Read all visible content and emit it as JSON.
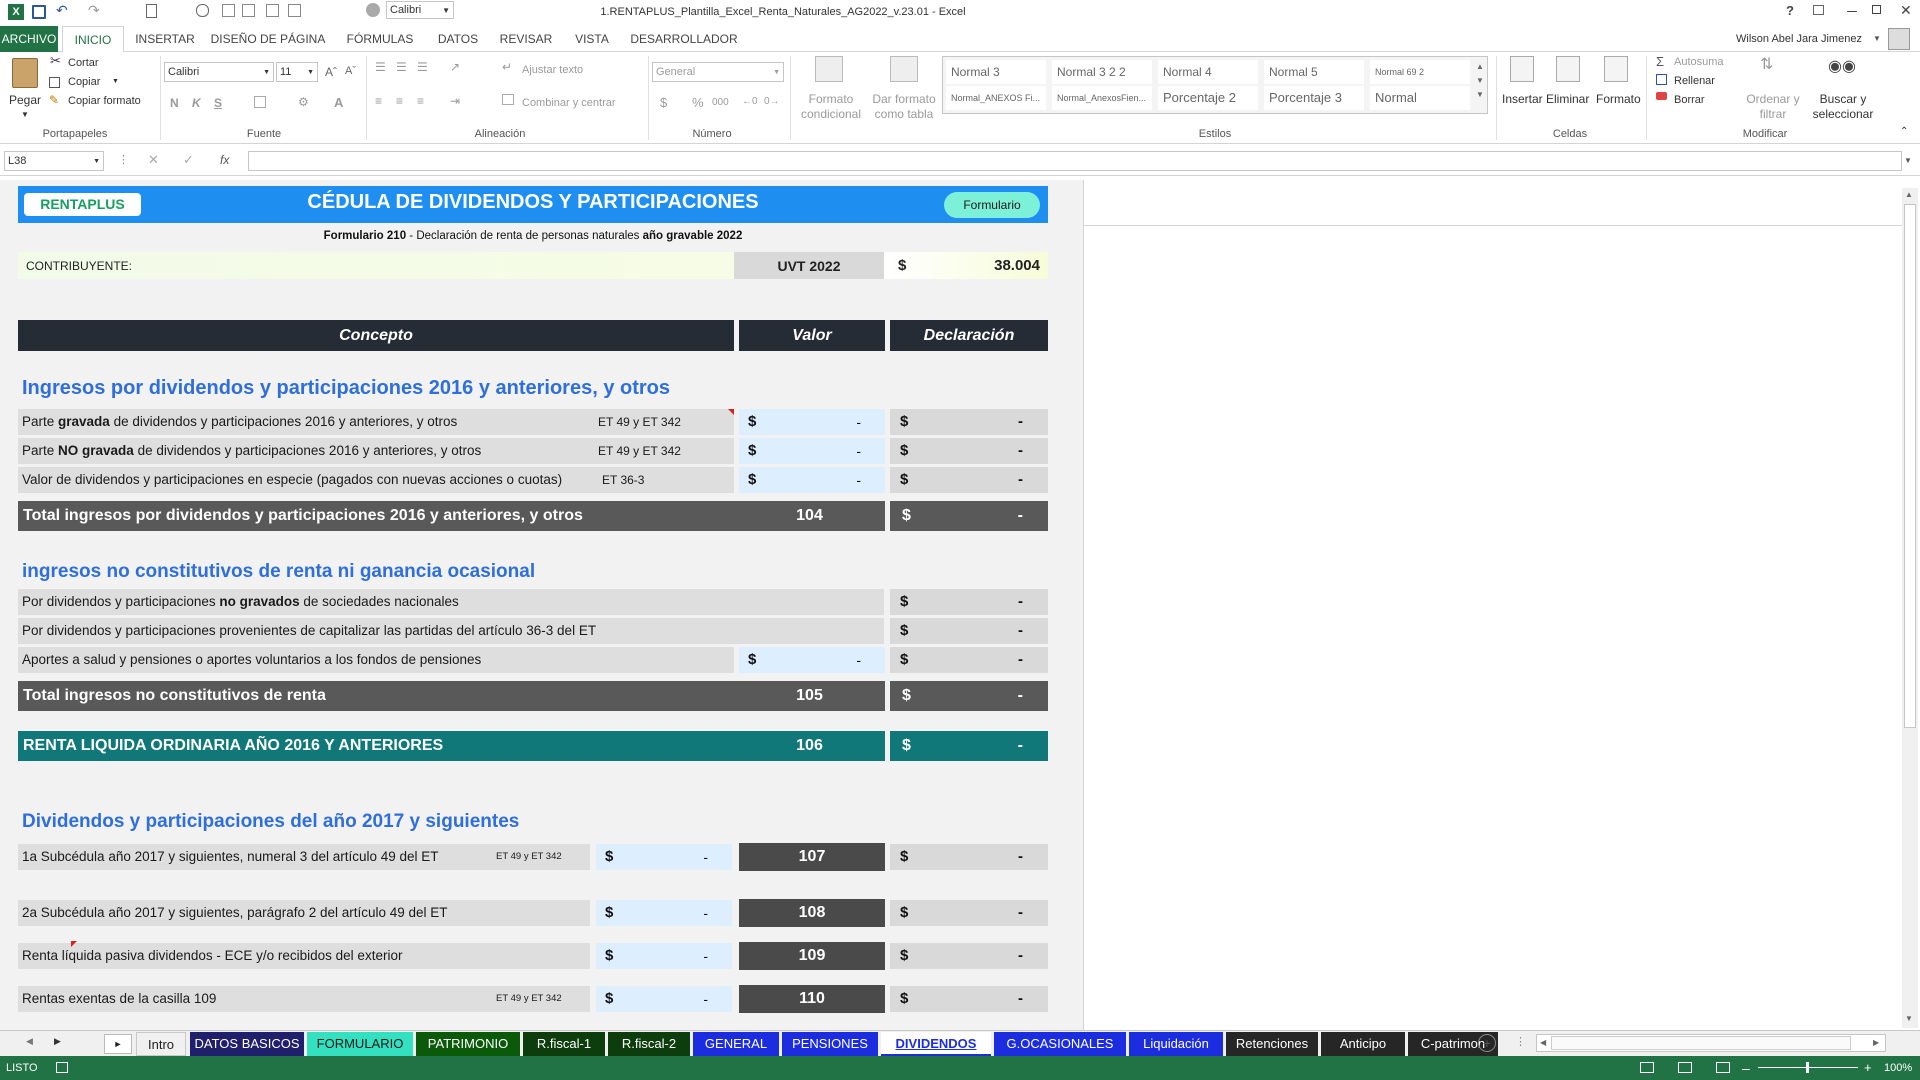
{
  "window": {
    "title": "1.RENTAPLUS_Plantilla_Excel_Renta_Naturales_AG2022_v.23.01 - Excel",
    "quick_font": "Calibri",
    "user": "Wilson Abel Jara Jimenez",
    "help": "?"
  },
  "ribbon_tabs": [
    "ARCHIVO",
    "INICIO",
    "INSERTAR",
    "DISEÑO DE PÁGINA",
    "FÓRMULAS",
    "DATOS",
    "REVISAR",
    "VISTA",
    "DESARROLLADOR"
  ],
  "ribbon": {
    "paste": "Pegar",
    "cut": "Cortar",
    "copy": "Copiar",
    "format_painter": "Copiar formato",
    "clipboard_group": "Portapapeles",
    "font_name": "Calibri",
    "font_size": "11",
    "font_group": "Fuente",
    "wrap_text": "Ajustar texto",
    "merge_center": "Combinar y centrar",
    "alignment_group": "Alineación",
    "number_format": "General",
    "number_group": "Número",
    "percent": "%",
    "thousands": "000",
    "cond_format_1": "Formato",
    "cond_format_2": "condicional",
    "table_format_1": "Dar formato",
    "table_format_2": "como tabla",
    "styles_group": "Estilos",
    "styles": [
      "Normal 3",
      "Normal 3 2 2",
      "Normal 4",
      "Normal 5",
      "Normal 69 2",
      "Normal_ANEXOS Fi...",
      "Normal_AnexosFien...",
      "Porcentaje 2",
      "Porcentaje 3",
      "Normal"
    ],
    "insert": "Insertar",
    "delete": "Eliminar",
    "format": "Formato",
    "cells_group": "Celdas",
    "autosum": "Autosuma",
    "fill": "Rellenar",
    "clear": "Borrar",
    "sort_filter_1": "Ordenar y",
    "sort_filter_2": "filtrar",
    "find_select_1": "Buscar y",
    "find_select_2": "seleccionar",
    "modify_group": "Modificar"
  },
  "formula_bar": {
    "name_box": "L38",
    "fx": "fx",
    "content": ""
  },
  "sheet": {
    "logo": "RENTAPLUS",
    "title": "CÉDULA DE DIVIDENDOS Y PARTICIPACIONES",
    "form_button": "Formulario",
    "subtitle_pre": "Formulario 210",
    "subtitle_mid": " - Declaración de renta de personas naturales ",
    "subtitle_bold": "año gravable 2022",
    "taxpayer_label": "CONTRIBUYENTE:",
    "uvt_label": "UVT 2022",
    "uvt_currency": "$",
    "uvt_value": "38.004",
    "headers": {
      "concept": "Concepto",
      "value": "Valor",
      "declaration": "Declaración"
    },
    "section1": {
      "title": "Ingresos por dividendos y participaciones 2016 y anteriores, y otros",
      "rows": [
        {
          "pre": "Parte ",
          "bold": "gravada",
          "post": " de dividendos y participaciones 2016 y anteriores, y otros",
          "ref": "ET 49 y ET 342",
          "cur": "$",
          "val": "-",
          "dcur": "$",
          "dval": "-"
        },
        {
          "pre": "Parte ",
          "bold": "NO gravada",
          "post": " de dividendos y participaciones 2016 y anteriores, y otros",
          "ref": "ET 49 y ET 342",
          "cur": "$",
          "val": "-",
          "dcur": "$",
          "dval": "-"
        },
        {
          "pre": "Valor de dividendos y participaciones en especie (pagados con nuevas acciones o cuotas)",
          "bold": "",
          "post": "",
          "ref": "ET 36-3",
          "cur": "$",
          "val": "-",
          "dcur": "$",
          "dval": "-"
        }
      ],
      "total_label": "Total ingresos por dividendos y participaciones 2016 y anteriores, y otros",
      "total_box": "104",
      "total_cur": "$",
      "total_val": "-"
    },
    "section2": {
      "title": "ingresos no constitutivos de renta ni ganancia ocasional",
      "rows": [
        {
          "pre": "Por dividendos y participaciones ",
          "bold": "no gravados",
          "post": " de sociedades nacionales",
          "dcur": "$",
          "dval": "-"
        },
        {
          "pre": "Por dividendos y participaciones provenientes de capitalizar las partidas del artículo 36-3 del ET",
          "bold": "",
          "post": "",
          "dcur": "$",
          "dval": "-"
        },
        {
          "pre": "Aportes a salud y pensiones o aportes voluntarios a los fondos de pensiones",
          "bold": "",
          "post": "",
          "cur": "$",
          "val": "-",
          "dcur": "$",
          "dval": "-"
        }
      ],
      "total_label": "Total ingresos no constitutivos de renta",
      "total_box": "105",
      "total_cur": "$",
      "total_val": "-"
    },
    "renta_liquida": {
      "label": "RENTA LIQUIDA ORDINARIA AÑO 2016 Y ANTERIORES",
      "box": "106",
      "cur": "$",
      "val": "-"
    },
    "section3": {
      "title": "Dividendos y participaciones del año 2017 y siguientes",
      "rows": [
        {
          "label": "1a Subcédula año 2017 y siguientes, numeral 3 del artículo 49 del ET",
          "ref": "ET 49 y ET 342",
          "cur": "$",
          "val": "-",
          "box": "107",
          "dcur": "$",
          "dval": "-"
        },
        {
          "label": "2a Subcédula año 2017 y siguientes, parágrafo 2 del artículo 49 del ET",
          "ref": "",
          "cur": "$",
          "val": "-",
          "box": "108",
          "dcur": "$",
          "dval": "-"
        },
        {
          "label": "Renta líquida pasiva dividendos - ECE y/o recibidos del exterior",
          "ref": "",
          "cur": "$",
          "val": "-",
          "box": "109",
          "dcur": "$",
          "dval": "-"
        },
        {
          "label": "Rentas exentas de la casilla 109",
          "ref": "ET 49 y ET 342",
          "cur": "$",
          "val": "-",
          "box": "110",
          "dcur": "$",
          "dval": "-"
        }
      ]
    }
  },
  "sheet_tabs": [
    {
      "label": "Intro",
      "bg": "#f0f0f0",
      "fg": "#222"
    },
    {
      "label": "DATOS BASICOS",
      "bg": "#1f1f6b",
      "fg": "#ffffff"
    },
    {
      "label": "FORMULARIO",
      "bg": "#33e0c0",
      "fg": "#1a1a1a"
    },
    {
      "label": "PATRIMONIO",
      "bg": "#0a5a0a",
      "fg": "#ffffff"
    },
    {
      "label": "R.fiscal-1",
      "bg": "#0d3d0d",
      "fg": "#ffffff"
    },
    {
      "label": "R.fiscal-2",
      "bg": "#0d3d0d",
      "fg": "#ffffff"
    },
    {
      "label": "GENERAL",
      "bg": "#1c2de0",
      "fg": "#ffffff"
    },
    {
      "label": "PENSIONES",
      "bg": "#1c2de0",
      "fg": "#ffffff"
    },
    {
      "label": "DIVIDENDOS",
      "bg": "#ffffff",
      "fg": "#1c2de0"
    },
    {
      "label": "G.OCASIONALES",
      "bg": "#1c2de0",
      "fg": "#ffffff"
    },
    {
      "label": "Liquidación",
      "bg": "#1c2de0",
      "fg": "#ffffff"
    },
    {
      "label": "Retenciones",
      "bg": "#262626",
      "fg": "#ffffff"
    },
    {
      "label": "Anticipo",
      "bg": "#262626",
      "fg": "#ffffff"
    },
    {
      "label": "C-patrimon",
      "bg": "#262626",
      "fg": "#ffffff"
    }
  ],
  "status": {
    "ready": "LISTO",
    "zoom": "100%"
  },
  "colors": {
    "excel_green": "#217346",
    "title_blue": "#1e8ff0",
    "section_blue": "#2f6fdc",
    "header_dark": "#262c35",
    "total_gray": "#595959",
    "teal": "#107878",
    "input_blue": "#ddeeff"
  }
}
